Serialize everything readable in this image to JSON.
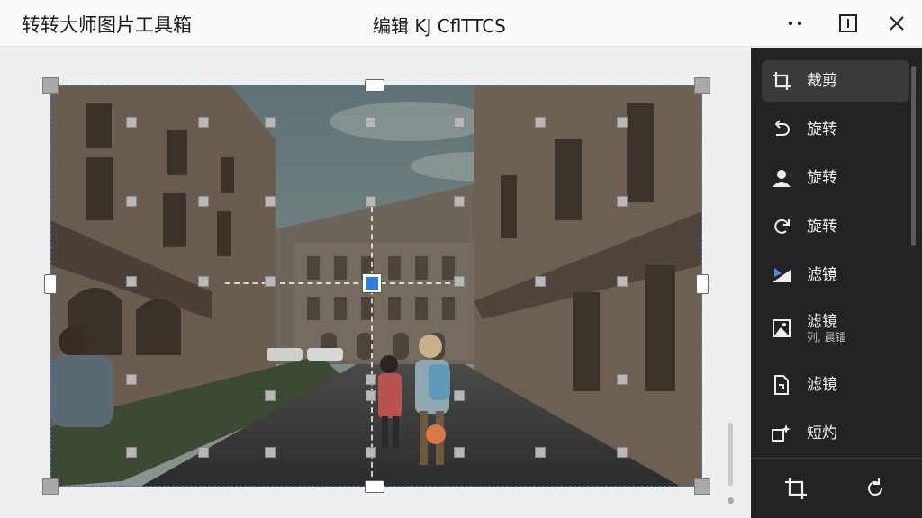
{
  "window": {
    "app_title": "转转大师图片工具箱",
    "doc_title": "编辑 KJ CflTTCS"
  },
  "sidebar": {
    "items": [
      {
        "label": "裁剪",
        "icon": "crop-icon",
        "active": true
      },
      {
        "label": "旋转",
        "icon": "rotate-left-icon"
      },
      {
        "label": "旋转",
        "icon": "person-icon"
      },
      {
        "label": "旋转",
        "icon": "rotate-right-icon"
      },
      {
        "label": "滤镜",
        "icon": "filter-icon"
      },
      {
        "label": "滤镜",
        "sub": "列, 晨镭",
        "icon": "image-icon"
      },
      {
        "label": "滤镜",
        "icon": "document-icon"
      },
      {
        "label": "短灼",
        "icon": "sparkle-icon"
      }
    ],
    "bottom": {
      "left_icon": "crop-icon",
      "right_icon": "reset-icon"
    }
  },
  "colors": {
    "accent": "#2f7de0",
    "sidebar_bg": "#232323",
    "crop_border": "#3b7bd8"
  }
}
